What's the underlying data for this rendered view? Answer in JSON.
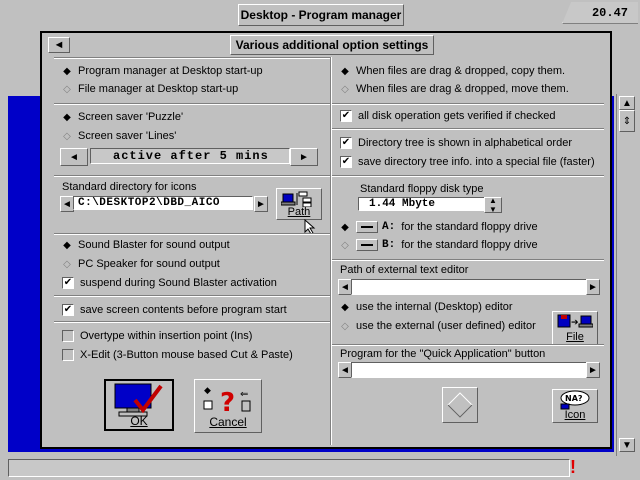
{
  "topbar": {
    "title": "Desktop - Program manager",
    "clock": "20.47"
  },
  "dialog": {
    "title": "Various additional option settings",
    "back_icon": "back-arrow-icon",
    "startup": {
      "option1": {
        "label": "Program manager at Desktop start-up",
        "selected": true
      },
      "option2": {
        "label": "File manager at Desktop start-up",
        "selected": false
      }
    },
    "screensaver": {
      "option1": {
        "label": "Screen saver 'Puzzle'",
        "selected": true
      },
      "option2": {
        "label": "Screen saver 'Lines'",
        "selected": false
      },
      "value": "active after 5 mins"
    },
    "icons_dir": {
      "label": "Standard directory for icons",
      "value": "C:\\DESKTOP2\\DBD_AICO",
      "path_button": "Path"
    },
    "sound": {
      "option1": {
        "label": "Sound Blaster for sound output",
        "selected": true
      },
      "option2": {
        "label": "PC Speaker for sound output",
        "selected": false
      },
      "suspend": {
        "label": "suspend during Sound Blaster activation",
        "checked": true
      }
    },
    "save_screen": {
      "label": "save screen contents before program start",
      "checked": true
    },
    "overtype": {
      "label": "Overtype within insertion point (Ins)",
      "checked": false
    },
    "xedit": {
      "label": "X-Edit  (3-Button mouse based Cut & Paste)",
      "checked": false
    },
    "ok_button": "OK",
    "cancel_button": "Cancel",
    "dragdrop": {
      "option1": {
        "label": "When files are drag & dropped, copy them.",
        "selected": true
      },
      "option2": {
        "label": "When files are drag & dropped, move them.",
        "selected": false
      }
    },
    "verify": {
      "label": "all disk operation gets verified if checked",
      "checked": true
    },
    "dirtree": {
      "alpha": {
        "label": "Directory tree is shown in alphabetical order",
        "checked": true
      },
      "save": {
        "label": "save directory tree info. into a special file (faster)",
        "checked": true
      }
    },
    "floppy": {
      "label": "Standard floppy disk type",
      "value": "1.44 Mbyte",
      "driveA": {
        "letter": "A:",
        "label": "for the standard floppy drive",
        "selected": true
      },
      "driveB": {
        "letter": "B:",
        "label": "for the standard floppy drive",
        "selected": false
      }
    },
    "editor": {
      "label": "Path of external text editor",
      "value": "",
      "internal": {
        "label": "use the internal (Desktop) editor",
        "selected": true
      },
      "external": {
        "label": "use the external (user defined) editor",
        "selected": false
      },
      "file_button": "File"
    },
    "quickapp": {
      "label": "Program for the \"Quick Application\" button",
      "value": "",
      "icon_button": "Icon",
      "icon_badge": "NA?"
    }
  }
}
